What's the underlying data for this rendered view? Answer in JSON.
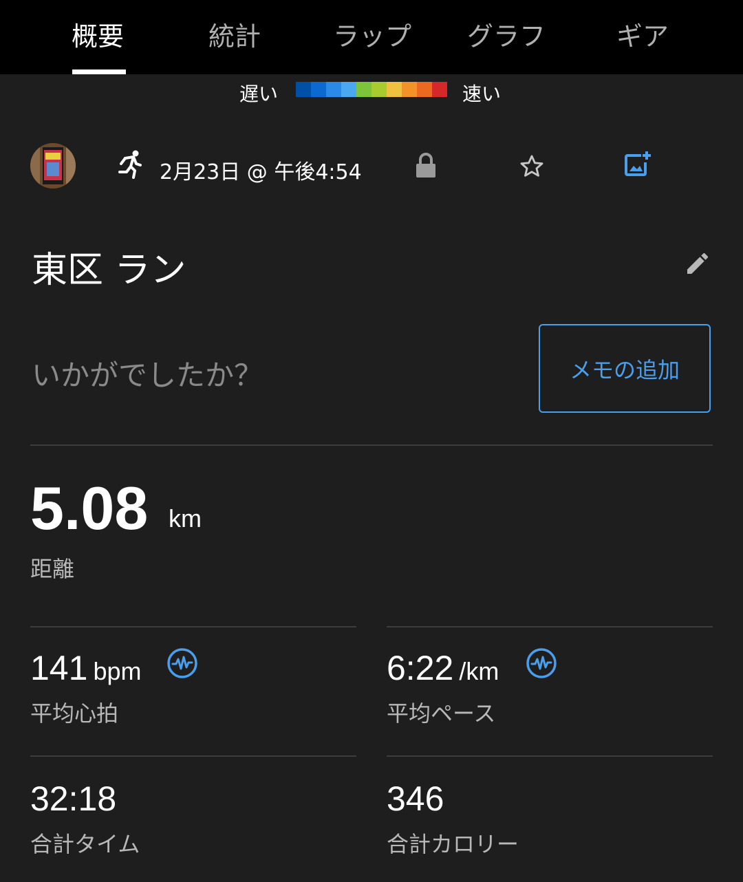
{
  "tabs": [
    {
      "label": "概要",
      "active": true
    },
    {
      "label": "統計",
      "active": false
    },
    {
      "label": "ラップ",
      "active": false
    },
    {
      "label": "グラフ",
      "active": false
    },
    {
      "label": "ギア",
      "active": false
    }
  ],
  "pace_legend": {
    "slow_label": "遅い",
    "fast_label": "速い",
    "colors": [
      "#0050a8",
      "#0a6ad0",
      "#2a8ae8",
      "#4aa8f0",
      "#7cc43a",
      "#a8cc30",
      "#f0c040",
      "#f4922a",
      "#ec6a20",
      "#d62828"
    ]
  },
  "activity": {
    "type_icon": "running-icon",
    "date_time": "2月23日 @ 午後4:54",
    "title": "東区 ラン",
    "prompt": "いかがでしたか？",
    "memo_button": "メモの追加"
  },
  "distance": {
    "value": "5.08",
    "unit": "km",
    "label": "距離"
  },
  "stats": {
    "avg_hr": {
      "value": "141",
      "unit": "bpm",
      "label": "平均心拍"
    },
    "avg_pace": {
      "value": "6:22",
      "unit": "/km",
      "label": "平均ペース"
    },
    "total_time": {
      "value": "32:18",
      "label": "合計タイム"
    },
    "total_calories": {
      "value": "346",
      "label": "合計カロリー"
    }
  },
  "colors": {
    "accent": "#4a9eea",
    "background": "#1e1e1e",
    "tabbar": "#000000"
  }
}
